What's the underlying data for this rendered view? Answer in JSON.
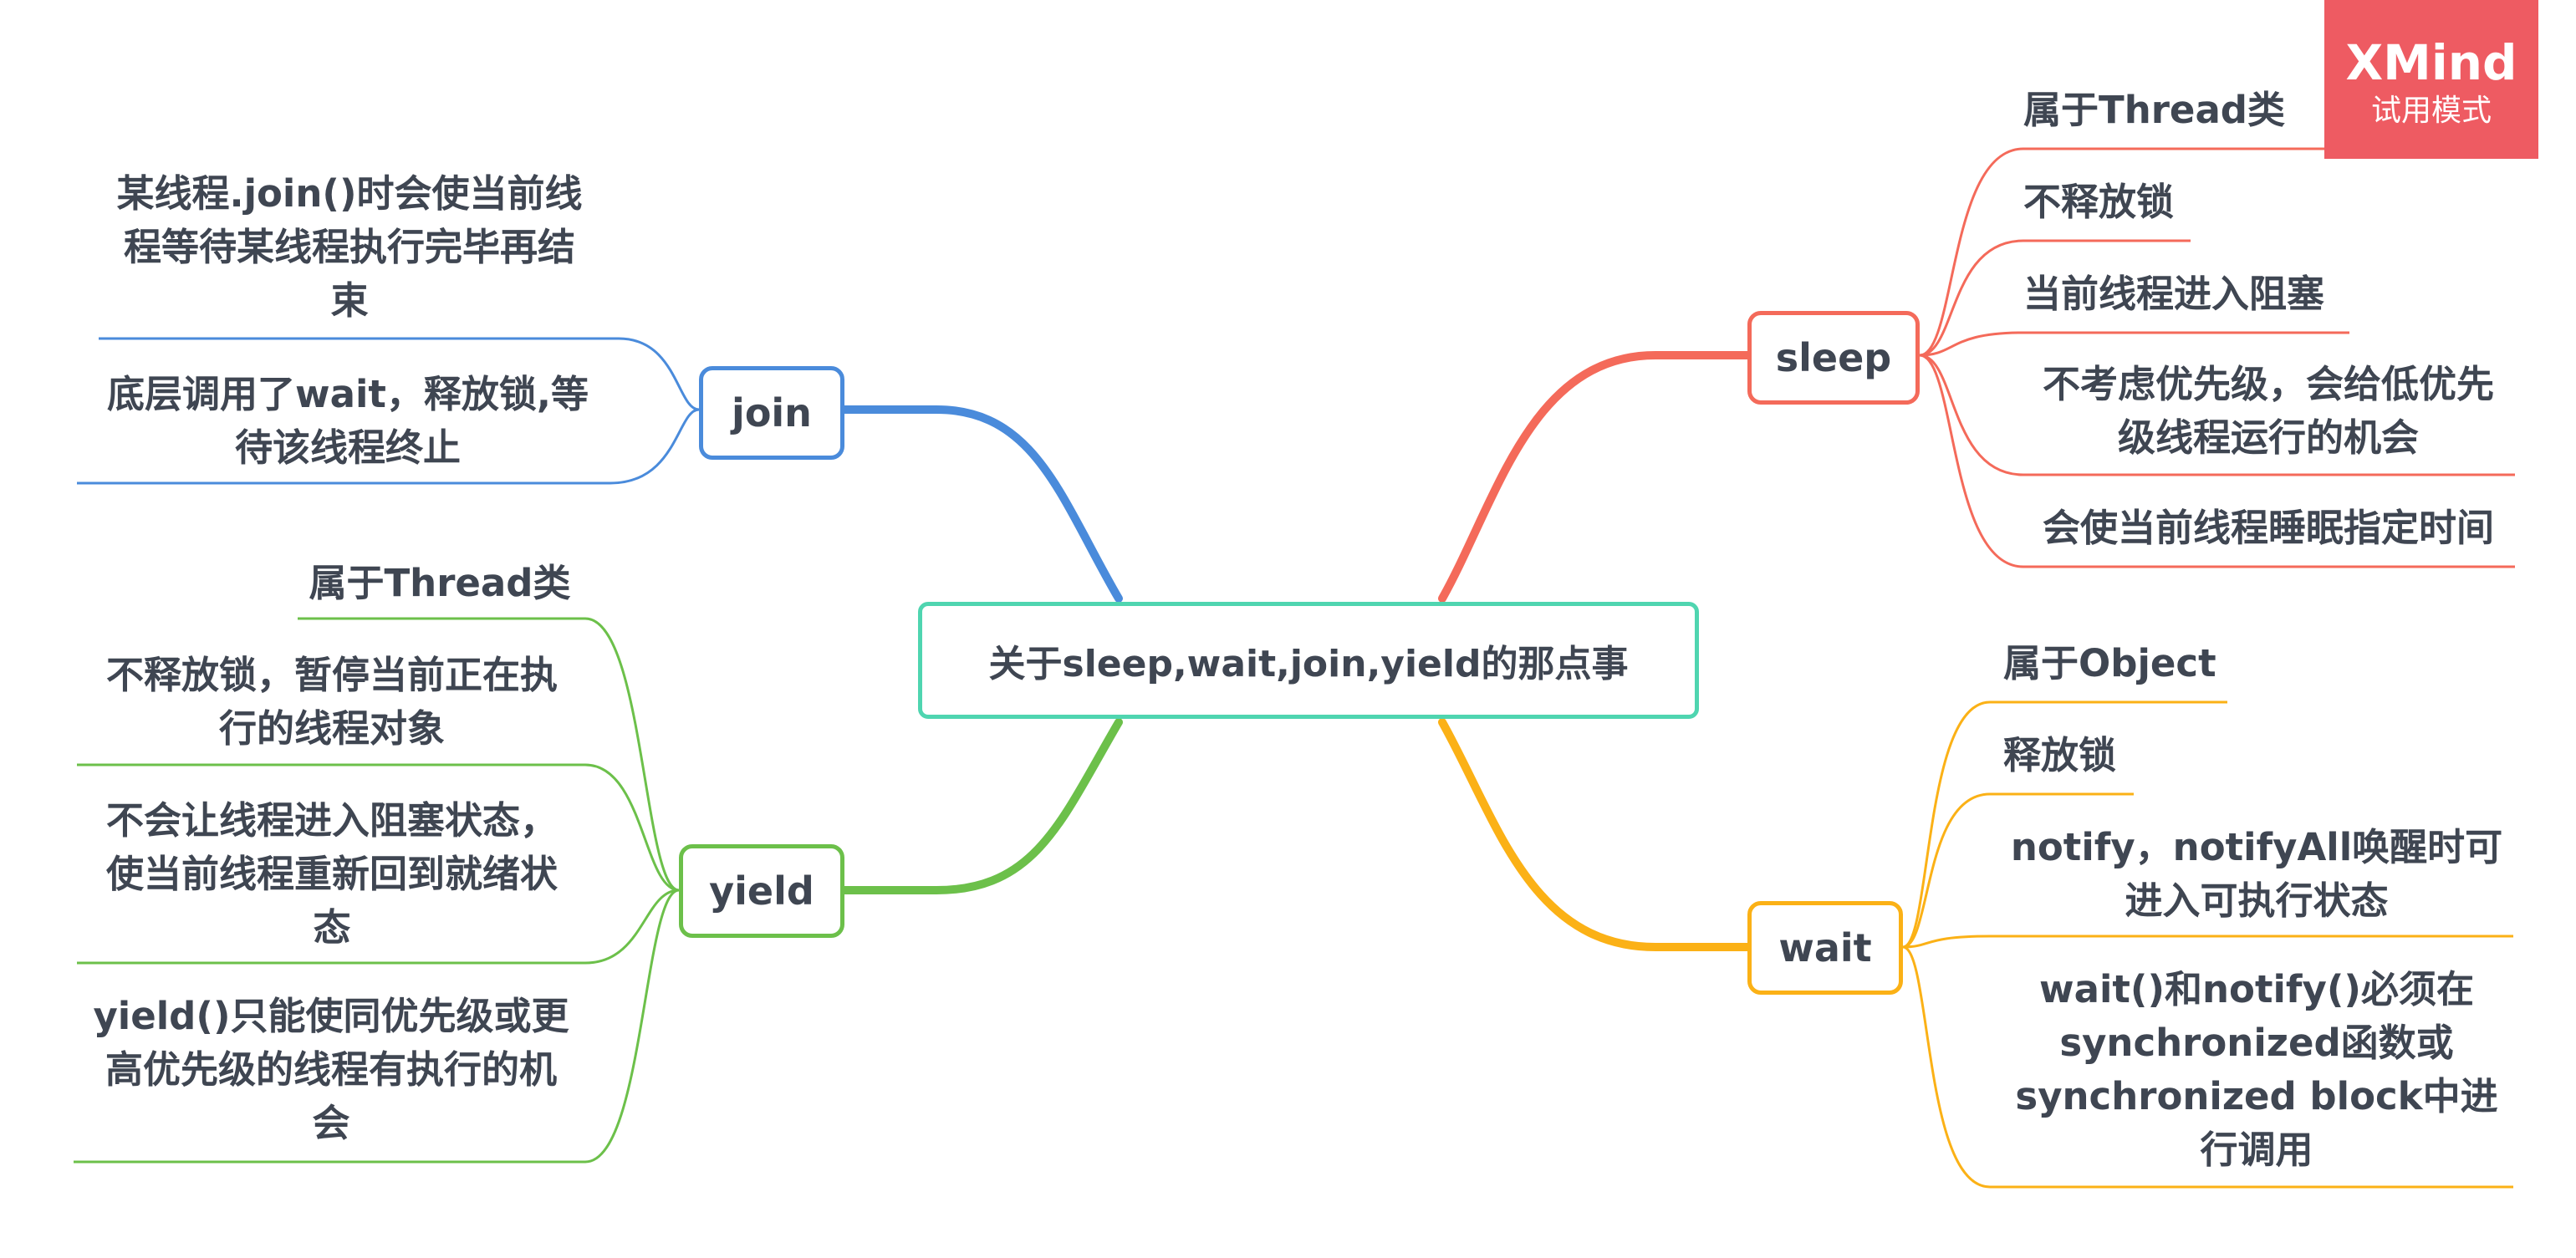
{
  "central": {
    "label": "关于sleep,wait,join,yield的那点事"
  },
  "badge": {
    "brand": "XMind",
    "mode": "试用模式"
  },
  "colors": {
    "central": "#4fd5b0",
    "join": "#4a8bdb",
    "yield": "#6cc04a",
    "sleep": "#f46a5a",
    "wait": "#fbb116",
    "badge": "#ee5b62",
    "text": "#3f4652"
  },
  "branches": {
    "join": {
      "label": "join",
      "items": [
        "某线程.join()时会使当前线\n程等待某线程执行完毕再结\n束",
        "底层调用了wait，释放锁,等\n待该线程终止"
      ]
    },
    "yield": {
      "label": "yield",
      "items": [
        "属于Thread类",
        "不释放锁，暂停当前正在执\n行的线程对象",
        "不会让线程进入阻塞状态，\n使当前线程重新回到就绪状\n态",
        "yield()只能使同优先级或更\n高优先级的线程有执行的机\n会"
      ]
    },
    "sleep": {
      "label": "sleep",
      "items": [
        "属于Thread类",
        "不释放锁",
        "当前线程进入阻塞",
        "不考虑优先级，会给低优先\n级线程运行的机会",
        "会使当前线程睡眠指定时间"
      ]
    },
    "wait": {
      "label": "wait",
      "items": [
        "属于Object",
        "释放锁",
        "notify，notifyAll唤醒时可\n进入可执行状态",
        "wait()和notify()必须在\nsynchronized函数或\nsynchronized    block中进\n行调用"
      ]
    }
  }
}
